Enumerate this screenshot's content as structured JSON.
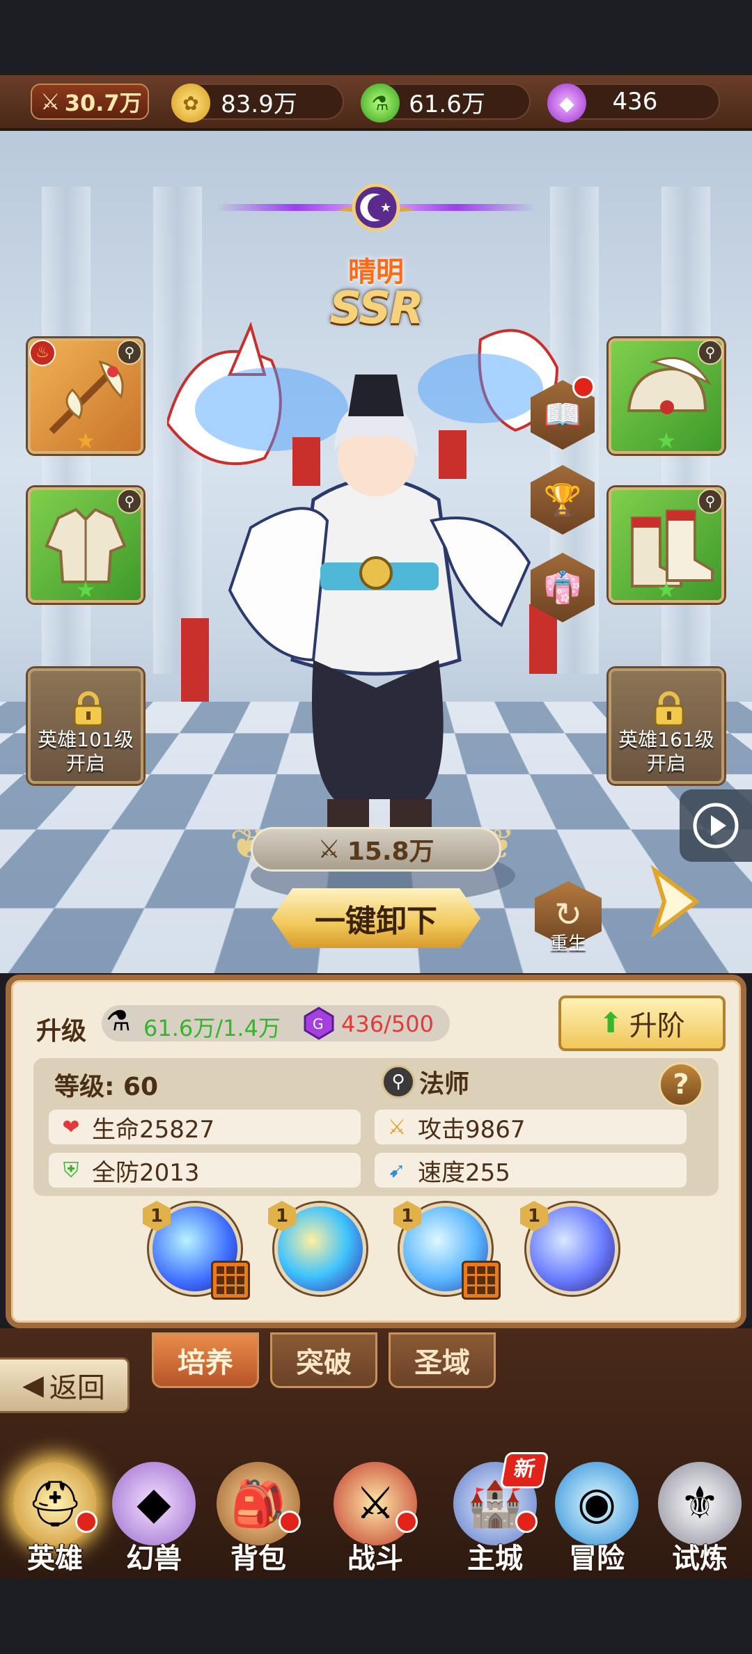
{
  "resources": {
    "power": "30.7万",
    "gold": "83.9万",
    "potion": "61.6万",
    "gems": "436"
  },
  "hero": {
    "name": "晴明",
    "rarity": "SSR",
    "power": "15.8万",
    "unload_label": "一键卸下",
    "rebirth_label": "重生"
  },
  "slots": {
    "locked_left_text_1": "英雄101级",
    "locked_left_text_2": "开启",
    "locked_right_text_1": "英雄161级",
    "locked_right_text_2": "开启"
  },
  "panel": {
    "upgrade_label": "升级",
    "potion_cost": "61.6万/1.4万",
    "gem_cost": "436/500",
    "advance_label": "升阶",
    "level": "等级: 60",
    "class": "法师",
    "help": "?",
    "hp": "生命25827",
    "attack": "攻击9867",
    "defense": "全防2013",
    "speed": "速度255",
    "skill_levels": [
      "1",
      "1",
      "1",
      "1"
    ]
  },
  "subtabs": [
    "培养",
    "突破",
    "圣域"
  ],
  "back_label": "返回",
  "nav": [
    "英雄",
    "幻兽",
    "背包",
    "战斗",
    "主城",
    "冒险",
    "试炼"
  ],
  "new_badge": "新",
  "colors": {
    "accent_orange": "#ff6a1a",
    "green_text": "#32b52a",
    "red_text": "#e23a3a"
  }
}
